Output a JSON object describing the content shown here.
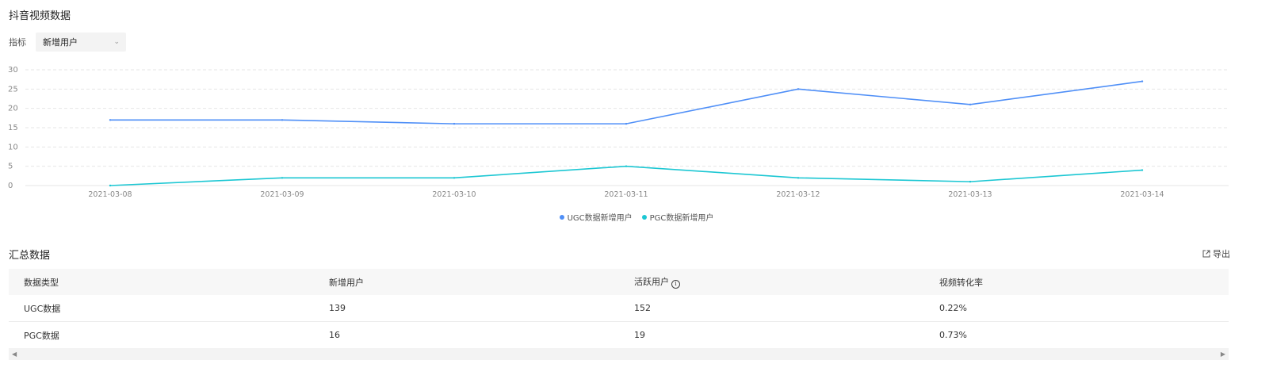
{
  "page": {
    "title": "抖音视频数据"
  },
  "filter": {
    "label": "指标",
    "selected": "新增用户"
  },
  "chart_data": {
    "type": "line",
    "x": [
      "2021-03-08",
      "2021-03-09",
      "2021-03-10",
      "2021-03-11",
      "2021-03-12",
      "2021-03-13",
      "2021-03-14"
    ],
    "ylim": [
      0,
      30
    ],
    "yticks": [
      0,
      5,
      10,
      15,
      20,
      25,
      30
    ],
    "grid": true,
    "legend_position": "bottom-center",
    "series": [
      {
        "name": "UGC数据新增用户",
        "color": "#4f8ff7",
        "values": [
          17,
          17,
          16,
          16,
          25,
          21,
          27
        ]
      },
      {
        "name": "PGC数据新增用户",
        "color": "#1cc7d3",
        "values": [
          0,
          2,
          2,
          5,
          2,
          1,
          4
        ]
      }
    ]
  },
  "summary": {
    "title": "汇总数据",
    "export_label": "导出",
    "columns": [
      "数据类型",
      "新增用户",
      "活跃用户",
      "视频转化率"
    ],
    "rows": [
      [
        "UGC数据",
        "139",
        "152",
        "0.22%"
      ],
      [
        "PGC数据",
        "16",
        "19",
        "0.73%"
      ]
    ]
  }
}
